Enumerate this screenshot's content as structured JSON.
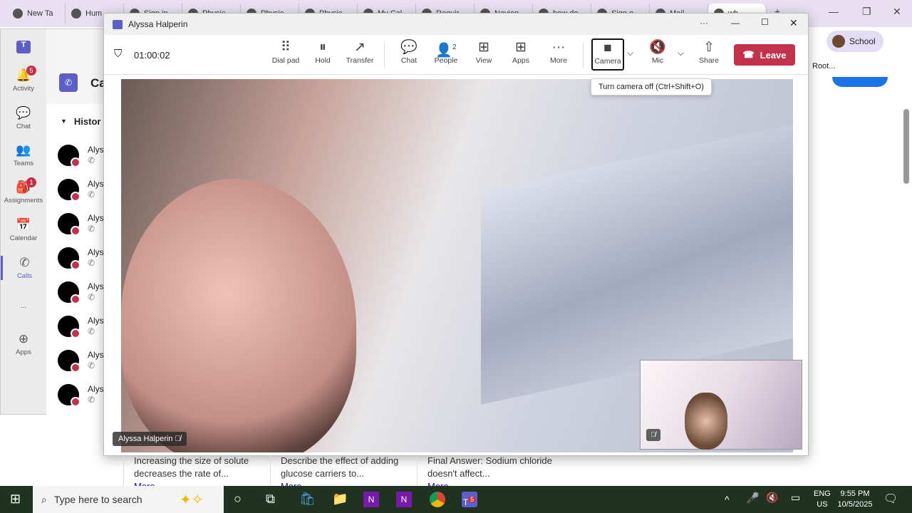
{
  "browser": {
    "tabs": [
      "New Ta",
      "Hum",
      "Sign in",
      "Physic",
      "Physic",
      "Physic",
      "My Cal",
      "Requir",
      "Navien",
      "how do",
      "Sign o",
      "Mail",
      "wh"
    ],
    "new_tab": "+",
    "profile": "School",
    "breadcrumb": "Root..."
  },
  "teams": {
    "rail": [
      {
        "label": "Activity",
        "badge": "5",
        "icon": "bell-icon"
      },
      {
        "label": "Chat",
        "icon": "chat-icon"
      },
      {
        "label": "Teams",
        "icon": "teams-icon"
      },
      {
        "label": "Assignments",
        "badge": "1",
        "icon": "assignments-icon"
      },
      {
        "label": "Calendar",
        "icon": "calendar-icon"
      },
      {
        "label": "Calls",
        "icon": "phone-icon"
      },
      {
        "label": "...",
        "icon": "more-icon"
      },
      {
        "label": "Apps",
        "icon": "apps-icon"
      }
    ],
    "page_title": "Ca",
    "history": "Histor",
    "contacts": [
      "Alys",
      "Alys",
      "Alys",
      "Alys",
      "Alys",
      "Alys",
      "Alys",
      "Alys"
    ]
  },
  "call": {
    "title": "Alyssa Halperin",
    "timer": "01:00:02",
    "toolbar": {
      "dialpad": "Dial pad",
      "hold": "Hold",
      "transfer": "Transfer",
      "chat": "Chat",
      "people": "People",
      "people_count": "2",
      "view": "View",
      "apps": "Apps",
      "more": "More",
      "camera": "Camera",
      "mic": "Mic",
      "share": "Share",
      "leave": "Leave"
    },
    "tooltip": "Turn camera off (Ctrl+Shift+O)",
    "participant_name": "Alyssa Halperin"
  },
  "cards": [
    {
      "text": "Increasing the size of solute decreases the rate of...",
      "more": "More"
    },
    {
      "text": "Describe the effect of adding glucose carriers to...",
      "more": "More"
    },
    {
      "text": "Final Answer: Sodium chloride doesn't affect...",
      "more": "More"
    }
  ],
  "taskbar": {
    "search_placeholder": "Type here to search",
    "teams_badge": "5",
    "lang": "ENG",
    "region": "US",
    "time": "9:55 PM",
    "date": "10/5/2025"
  },
  "colors": {
    "leave": "#c4314b",
    "teams_accent": "#5b5fc7",
    "taskbar": "#1f3320"
  }
}
